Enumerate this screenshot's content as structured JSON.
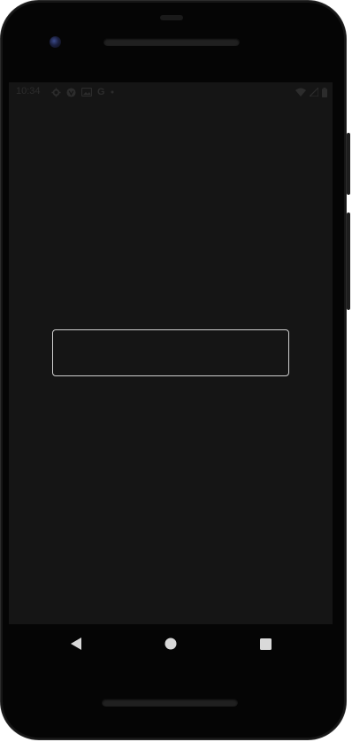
{
  "status_bar": {
    "time": "10:34",
    "left_icons": [
      "settings-icon",
      "vpn-icon",
      "image-icon",
      "google-icon",
      "dot-icon"
    ],
    "google_glyph": "G",
    "right_icons": [
      "wifi-icon",
      "cellular-icon",
      "battery-icon"
    ]
  },
  "main": {
    "text_field": {
      "value": "",
      "placeholder": ""
    }
  },
  "nav_bar": {
    "buttons": [
      "back-icon",
      "home-icon",
      "recents-icon"
    ]
  },
  "colors": {
    "screen_background": "#151515",
    "device_frame": "#050505",
    "text_field_border": "#cfcfcf",
    "nav_icon": "#d9d9d9",
    "status_icon": "#2c2c2c"
  }
}
